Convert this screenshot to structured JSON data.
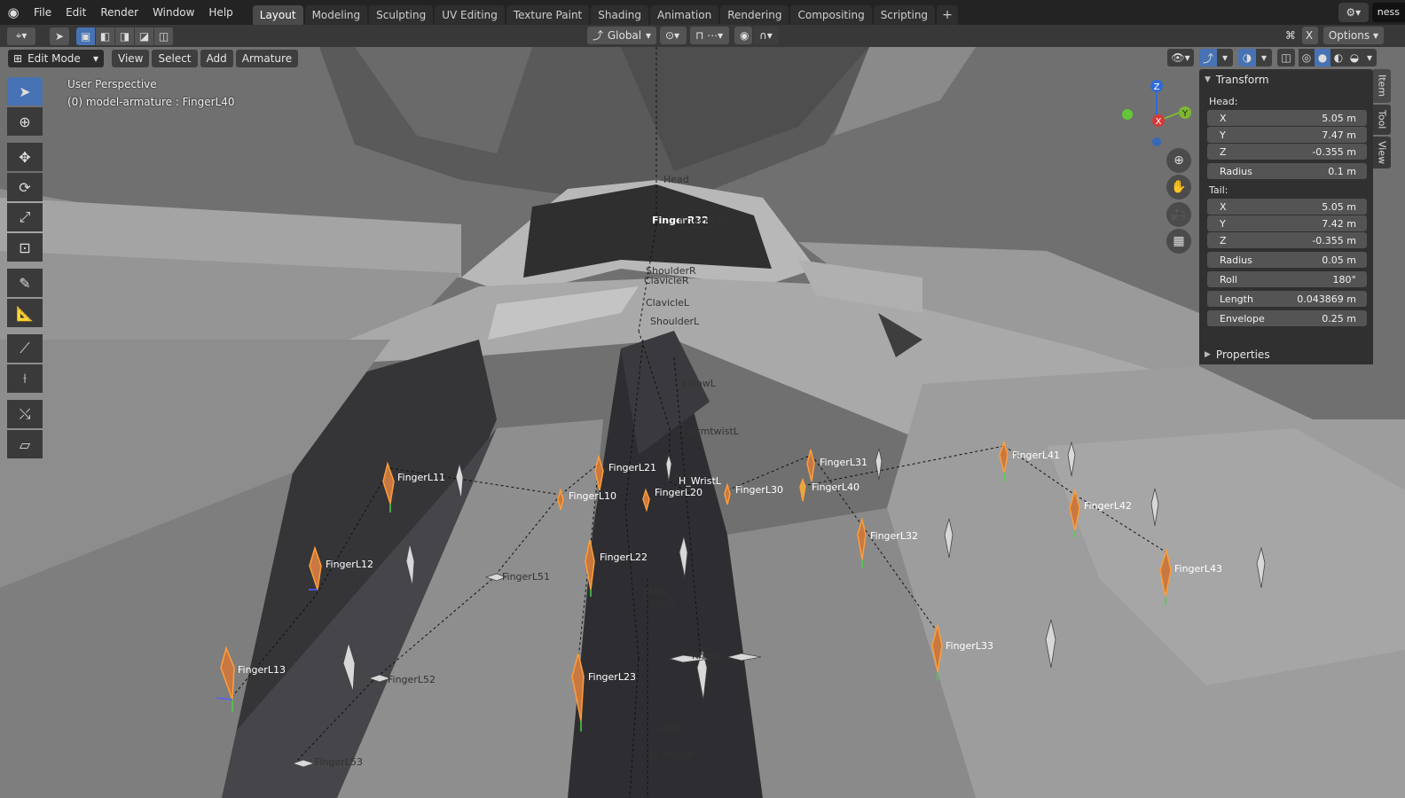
{
  "menu": {
    "items": [
      "File",
      "Edit",
      "Render",
      "Window",
      "Help"
    ]
  },
  "workspaces": {
    "tabs": [
      "Layout",
      "Modeling",
      "Sculpting",
      "UV Editing",
      "Texture Paint",
      "Shading",
      "Animation",
      "Rendering",
      "Compositing",
      "Scripting"
    ],
    "active": "Layout",
    "add": "+"
  },
  "topbar": {
    "scene_name": "ness"
  },
  "tool_header": {
    "orientation": "Global",
    "close_label": "X",
    "options_label": "Options"
  },
  "mode_header": {
    "mode": "Edit Mode",
    "view": "View",
    "select": "Select",
    "add": "Add",
    "armature": "Armature"
  },
  "viewport": {
    "perspective": "User Perspective",
    "active_object": "(0) model-armature : FingerL40"
  },
  "gizmo": {
    "z": "Z",
    "y": "Y",
    "x": "X"
  },
  "npanel": {
    "transform_title": "Transform",
    "head_label": "Head:",
    "head": [
      {
        "axis": "X",
        "value": "5.05 m"
      },
      {
        "axis": "Y",
        "value": "7.47 m"
      },
      {
        "axis": "Z",
        "value": "-0.355 m"
      }
    ],
    "head_radius": {
      "label": "Radius",
      "value": "0.1 m"
    },
    "tail_label": "Tail:",
    "tail": [
      {
        "axis": "X",
        "value": "5.05 m"
      },
      {
        "axis": "Y",
        "value": "7.42 m"
      },
      {
        "axis": "Z",
        "value": "-0.355 m"
      }
    ],
    "tail_radius": {
      "label": "Radius",
      "value": "0.05 m"
    },
    "roll": {
      "label": "Roll",
      "value": "180°"
    },
    "length": {
      "label": "Length",
      "value": "0.043869 m"
    },
    "envelope": {
      "label": "Envelope",
      "value": "0.25 m"
    },
    "properties_title": "Properties"
  },
  "sidetabs": [
    "Item",
    "Tool",
    "View"
  ],
  "bones": {
    "FingerL11": "FingerL11",
    "FingerL12": "FingerL12",
    "FingerL13": "FingerL13",
    "FingerL10": "FingerL10",
    "FingerL21": "FingerL21",
    "FingerL20": "FingerL20",
    "FingerL22": "FingerL22",
    "FingerL23": "FingerL23",
    "FingerL30": "FingerL30",
    "FingerL31": "FingerL31",
    "FingerL40": "FingerL40",
    "FingerL32": "FingerL32",
    "FingerL33": "FingerL33",
    "FingerL41": "FingerL41",
    "FingerL42": "FingerL42",
    "FingerL43": "FingerL43",
    "FingerL51": "FingerL51",
    "FingerL52": "FingerL52",
    "FingerL53": "FingerL53",
    "Head": "Head",
    "FingerR32": "FingerR32",
    "FingerR42": "FingerR42",
    "ShoulderR": "ShoulderR",
    "ClavicleR": "ClavicleR",
    "ClavicleL": "ClavicleL",
    "ShoulderL": "ShoulderL",
    "ElbowL": "ElbowL",
    "ArmtwistL": "H_ArmtwistL",
    "WristL": "H_WristL",
    "Waist": "Waist",
    "LegR": "LegR",
    "KneeL": "KneeL",
    "LegL": "LegL",
    "KneeR": "H_KneeR"
  }
}
